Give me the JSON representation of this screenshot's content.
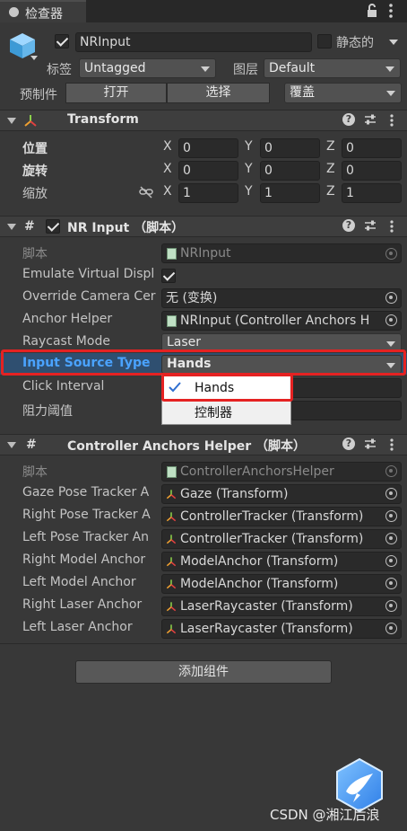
{
  "tab": {
    "label": "检查器"
  },
  "object": {
    "enabled": true,
    "name": "NRInput",
    "static_label": "静态的",
    "static_checked": false,
    "tag_label": "标签",
    "tag_value": "Untagged",
    "layer_label": "图层",
    "layer_value": "Default",
    "prefab_label": "预制件",
    "open_label": "打开",
    "select_label": "选择",
    "override_label": "覆盖"
  },
  "transform": {
    "title": "Transform",
    "rows": [
      {
        "label": "位置",
        "x": "0",
        "y": "0",
        "z": "0"
      },
      {
        "label": "旋转",
        "x": "0",
        "y": "0",
        "z": "0"
      },
      {
        "label": "缩放",
        "x": "1",
        "y": "1",
        "z": "1"
      }
    ],
    "axes": {
      "x": "X",
      "y": "Y",
      "z": "Z"
    }
  },
  "nrinput": {
    "title": "NR Input （脚本）",
    "enabled": true,
    "script_label": "脚本",
    "script_value": "NRInput",
    "emulate_label": "Emulate Virtual Displ",
    "emulate_checked": true,
    "override_label": "Override Camera Cer",
    "override_value": "无 (变换)",
    "anchor_label": "Anchor Helper",
    "anchor_value": "NRInput (Controller Anchors H",
    "raycast_label": "Raycast Mode",
    "raycast_value": "Laser",
    "input_source_label": "Input Source Type",
    "input_source_value": "Hands",
    "click_label": "Click Interval",
    "damping_label": "阻力阈值",
    "options": [
      "Hands",
      "控制器"
    ]
  },
  "anchors": {
    "title": "Controller Anchors Helper （脚本）",
    "script_label": "脚本",
    "script_value": "ControllerAnchorsHelper",
    "rows": [
      {
        "label": "Gaze Pose Tracker A",
        "value": "Gaze (Transform)"
      },
      {
        "label": "Right Pose Tracker A",
        "value": "ControllerTracker (Transform)"
      },
      {
        "label": "Left Pose Tracker An",
        "value": "ControllerTracker (Transform)"
      },
      {
        "label": "Right Model Anchor",
        "value": "ModelAnchor (Transform)"
      },
      {
        "label": "Left Model Anchor",
        "value": "ModelAnchor (Transform)"
      },
      {
        "label": "Right Laser Anchor",
        "value": "LaserRaycaster (Transform)"
      },
      {
        "label": "Left Laser Anchor",
        "value": "LaserRaycaster (Transform)"
      }
    ]
  },
  "add_component_label": "添加组件",
  "watermark": "CSDN @湘江后浪",
  "colors": {
    "highlight": "#e52222",
    "accent_blue": "#4aa3ff"
  }
}
